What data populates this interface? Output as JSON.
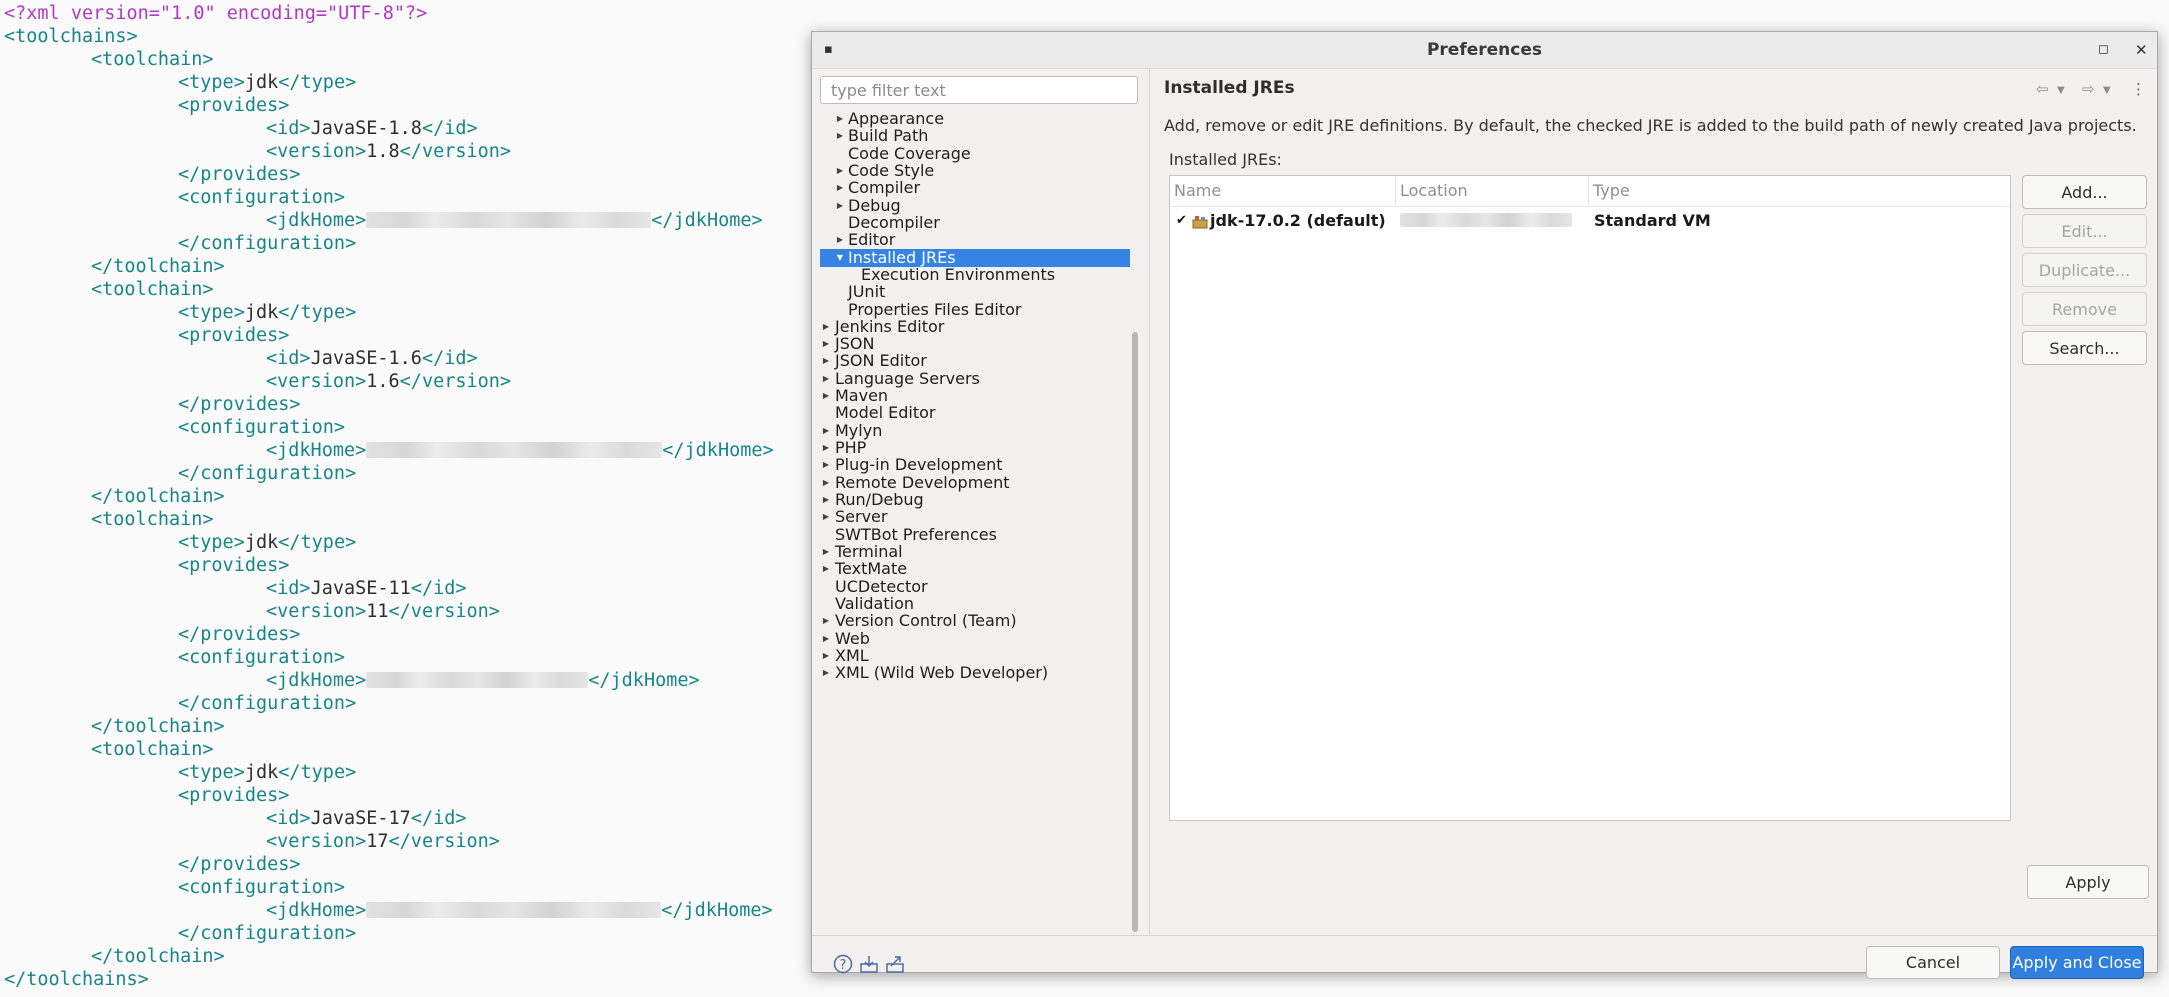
{
  "editor": {
    "lines": [
      {
        "indent": 0,
        "decl": "<?xml version=\"1.0\" encoding=\"UTF-8\"?>"
      },
      {
        "indent": 0,
        "open": "<toolchains>"
      },
      {
        "indent": 1,
        "open": "<toolchain>"
      },
      {
        "indent": 2,
        "open": "<type>",
        "text": "jdk",
        "close": "</type>"
      },
      {
        "indent": 2,
        "open": "<provides>"
      },
      {
        "indent": 3,
        "open": "<id>",
        "text": "JavaSE-1.8",
        "close": "</id>"
      },
      {
        "indent": 3,
        "open": "<version>",
        "text": "1.8",
        "close": "</version>"
      },
      {
        "indent": 2,
        "open": "</provides>"
      },
      {
        "indent": 2,
        "open": "<configuration>"
      },
      {
        "indent": 3,
        "open": "<jdkHome>",
        "redacted": 285,
        "close": "</jdkHome>"
      },
      {
        "indent": 2,
        "open": "</configuration>"
      },
      {
        "indent": 1,
        "open": "</toolchain>"
      },
      {
        "indent": 1,
        "open": "<toolchain>"
      },
      {
        "indent": 2,
        "open": "<type>",
        "text": "jdk",
        "close": "</type>"
      },
      {
        "indent": 2,
        "open": "<provides>"
      },
      {
        "indent": 3,
        "open": "<id>",
        "text": "JavaSE-1.6",
        "close": "</id>"
      },
      {
        "indent": 3,
        "open": "<version>",
        "text": "1.6",
        "close": "</version>"
      },
      {
        "indent": 2,
        "open": "</provides>"
      },
      {
        "indent": 2,
        "open": "<configuration>"
      },
      {
        "indent": 3,
        "open": "<jdkHome>",
        "redacted": 296,
        "close": "</jdkHome>"
      },
      {
        "indent": 2,
        "open": "</configuration>"
      },
      {
        "indent": 1,
        "open": "</toolchain>"
      },
      {
        "indent": 1,
        "open": "<toolchain>"
      },
      {
        "indent": 2,
        "open": "<type>",
        "text": "jdk",
        "close": "</type>"
      },
      {
        "indent": 2,
        "open": "<provides>"
      },
      {
        "indent": 3,
        "open": "<id>",
        "text": "JavaSE-11",
        "close": "</id>"
      },
      {
        "indent": 3,
        "open": "<version>",
        "text": "11",
        "close": "</version>"
      },
      {
        "indent": 2,
        "open": "</provides>"
      },
      {
        "indent": 2,
        "open": "<configuration>"
      },
      {
        "indent": 3,
        "open": "<jdkHome>",
        "redacted": 222,
        "close": "</jdkHome>"
      },
      {
        "indent": 2,
        "open": "</configuration>"
      },
      {
        "indent": 1,
        "open": "</toolchain>"
      },
      {
        "indent": 1,
        "open": "<toolchain>"
      },
      {
        "indent": 2,
        "open": "<type>",
        "text": "jdk",
        "close": "</type>"
      },
      {
        "indent": 2,
        "open": "<provides>"
      },
      {
        "indent": 3,
        "open": "<id>",
        "text": "JavaSE-17",
        "close": "</id>"
      },
      {
        "indent": 3,
        "open": "<version>",
        "text": "17",
        "close": "</version>"
      },
      {
        "indent": 2,
        "open": "</provides>"
      },
      {
        "indent": 2,
        "open": "<configuration>"
      },
      {
        "indent": 3,
        "open": "<jdkHome>",
        "redacted": 295,
        "close": "</jdkHome>"
      },
      {
        "indent": 2,
        "open": "</configuration>"
      },
      {
        "indent": 1,
        "open": "</toolchain>"
      },
      {
        "indent": 0,
        "open": "</toolchains>"
      }
    ]
  },
  "dialog": {
    "title": "Preferences",
    "filter_placeholder": "type filter text",
    "tree": [
      {
        "label": "Appearance",
        "level": 1,
        "expander": "collapsed"
      },
      {
        "label": "Build Path",
        "level": 1,
        "expander": "collapsed"
      },
      {
        "label": "Code Coverage",
        "level": 1,
        "expander": "none"
      },
      {
        "label": "Code Style",
        "level": 1,
        "expander": "collapsed"
      },
      {
        "label": "Compiler",
        "level": 1,
        "expander": "collapsed"
      },
      {
        "label": "Debug",
        "level": 1,
        "expander": "collapsed"
      },
      {
        "label": "Decompiler",
        "level": 1,
        "expander": "none"
      },
      {
        "label": "Editor",
        "level": 1,
        "expander": "collapsed"
      },
      {
        "label": "Installed JREs",
        "level": 1,
        "expander": "expanded",
        "selected": true
      },
      {
        "label": "Execution Environments",
        "level": 2,
        "expander": "none"
      },
      {
        "label": "JUnit",
        "level": 1,
        "expander": "none"
      },
      {
        "label": "Properties Files Editor",
        "level": 1,
        "expander": "none"
      },
      {
        "label": "Jenkins Editor",
        "level": 0,
        "expander": "collapsed"
      },
      {
        "label": "JSON",
        "level": 0,
        "expander": "collapsed"
      },
      {
        "label": "JSON Editor",
        "level": 0,
        "expander": "collapsed"
      },
      {
        "label": "Language Servers",
        "level": 0,
        "expander": "collapsed"
      },
      {
        "label": "Maven",
        "level": 0,
        "expander": "collapsed"
      },
      {
        "label": "Model Editor",
        "level": 0,
        "expander": "none"
      },
      {
        "label": "Mylyn",
        "level": 0,
        "expander": "collapsed"
      },
      {
        "label": "PHP",
        "level": 0,
        "expander": "collapsed"
      },
      {
        "label": "Plug-in Development",
        "level": 0,
        "expander": "collapsed"
      },
      {
        "label": "Remote Development",
        "level": 0,
        "expander": "collapsed"
      },
      {
        "label": "Run/Debug",
        "level": 0,
        "expander": "collapsed"
      },
      {
        "label": "Server",
        "level": 0,
        "expander": "collapsed"
      },
      {
        "label": "SWTBot Preferences",
        "level": 0,
        "expander": "none"
      },
      {
        "label": "Terminal",
        "level": 0,
        "expander": "collapsed"
      },
      {
        "label": "TextMate",
        "level": 0,
        "expander": "collapsed"
      },
      {
        "label": "UCDetector",
        "level": 0,
        "expander": "none"
      },
      {
        "label": "Validation",
        "level": 0,
        "expander": "none"
      },
      {
        "label": "Version Control (Team)",
        "level": 0,
        "expander": "collapsed"
      },
      {
        "label": "Web",
        "level": 0,
        "expander": "collapsed"
      },
      {
        "label": "XML",
        "level": 0,
        "expander": "collapsed"
      },
      {
        "label": "XML (Wild Web Developer)",
        "level": 0,
        "expander": "collapsed"
      }
    ],
    "page": {
      "title": "Installed JREs",
      "description": "Add, remove or edit JRE definitions. By default, the checked JRE is added to the build path of newly created Java projects.",
      "table_label": "Installed JREs:",
      "columns": [
        "Name",
        "Location",
        "Type"
      ],
      "rows": [
        {
          "name": "jdk-17.0.2 (default)",
          "location_redacted": true,
          "type": "Standard VM",
          "checked": true
        }
      ],
      "buttons": {
        "add": "Add...",
        "edit": "Edit...",
        "duplicate": "Duplicate...",
        "remove": "Remove",
        "search": "Search..."
      },
      "apply": "Apply"
    },
    "footer": {
      "cancel": "Cancel",
      "apply_close": "Apply and Close"
    },
    "icons": {
      "help": "help-icon",
      "import": "import-icon",
      "export": "export-icon",
      "back": "back-arrow-icon",
      "forward": "forward-arrow-icon",
      "menu": "view-menu-icon"
    },
    "colors": {
      "selection": "#3584e4",
      "primary_button": "#2f7fde",
      "xml_tag": "#17858a",
      "xml_decl": "#b238c8"
    }
  }
}
